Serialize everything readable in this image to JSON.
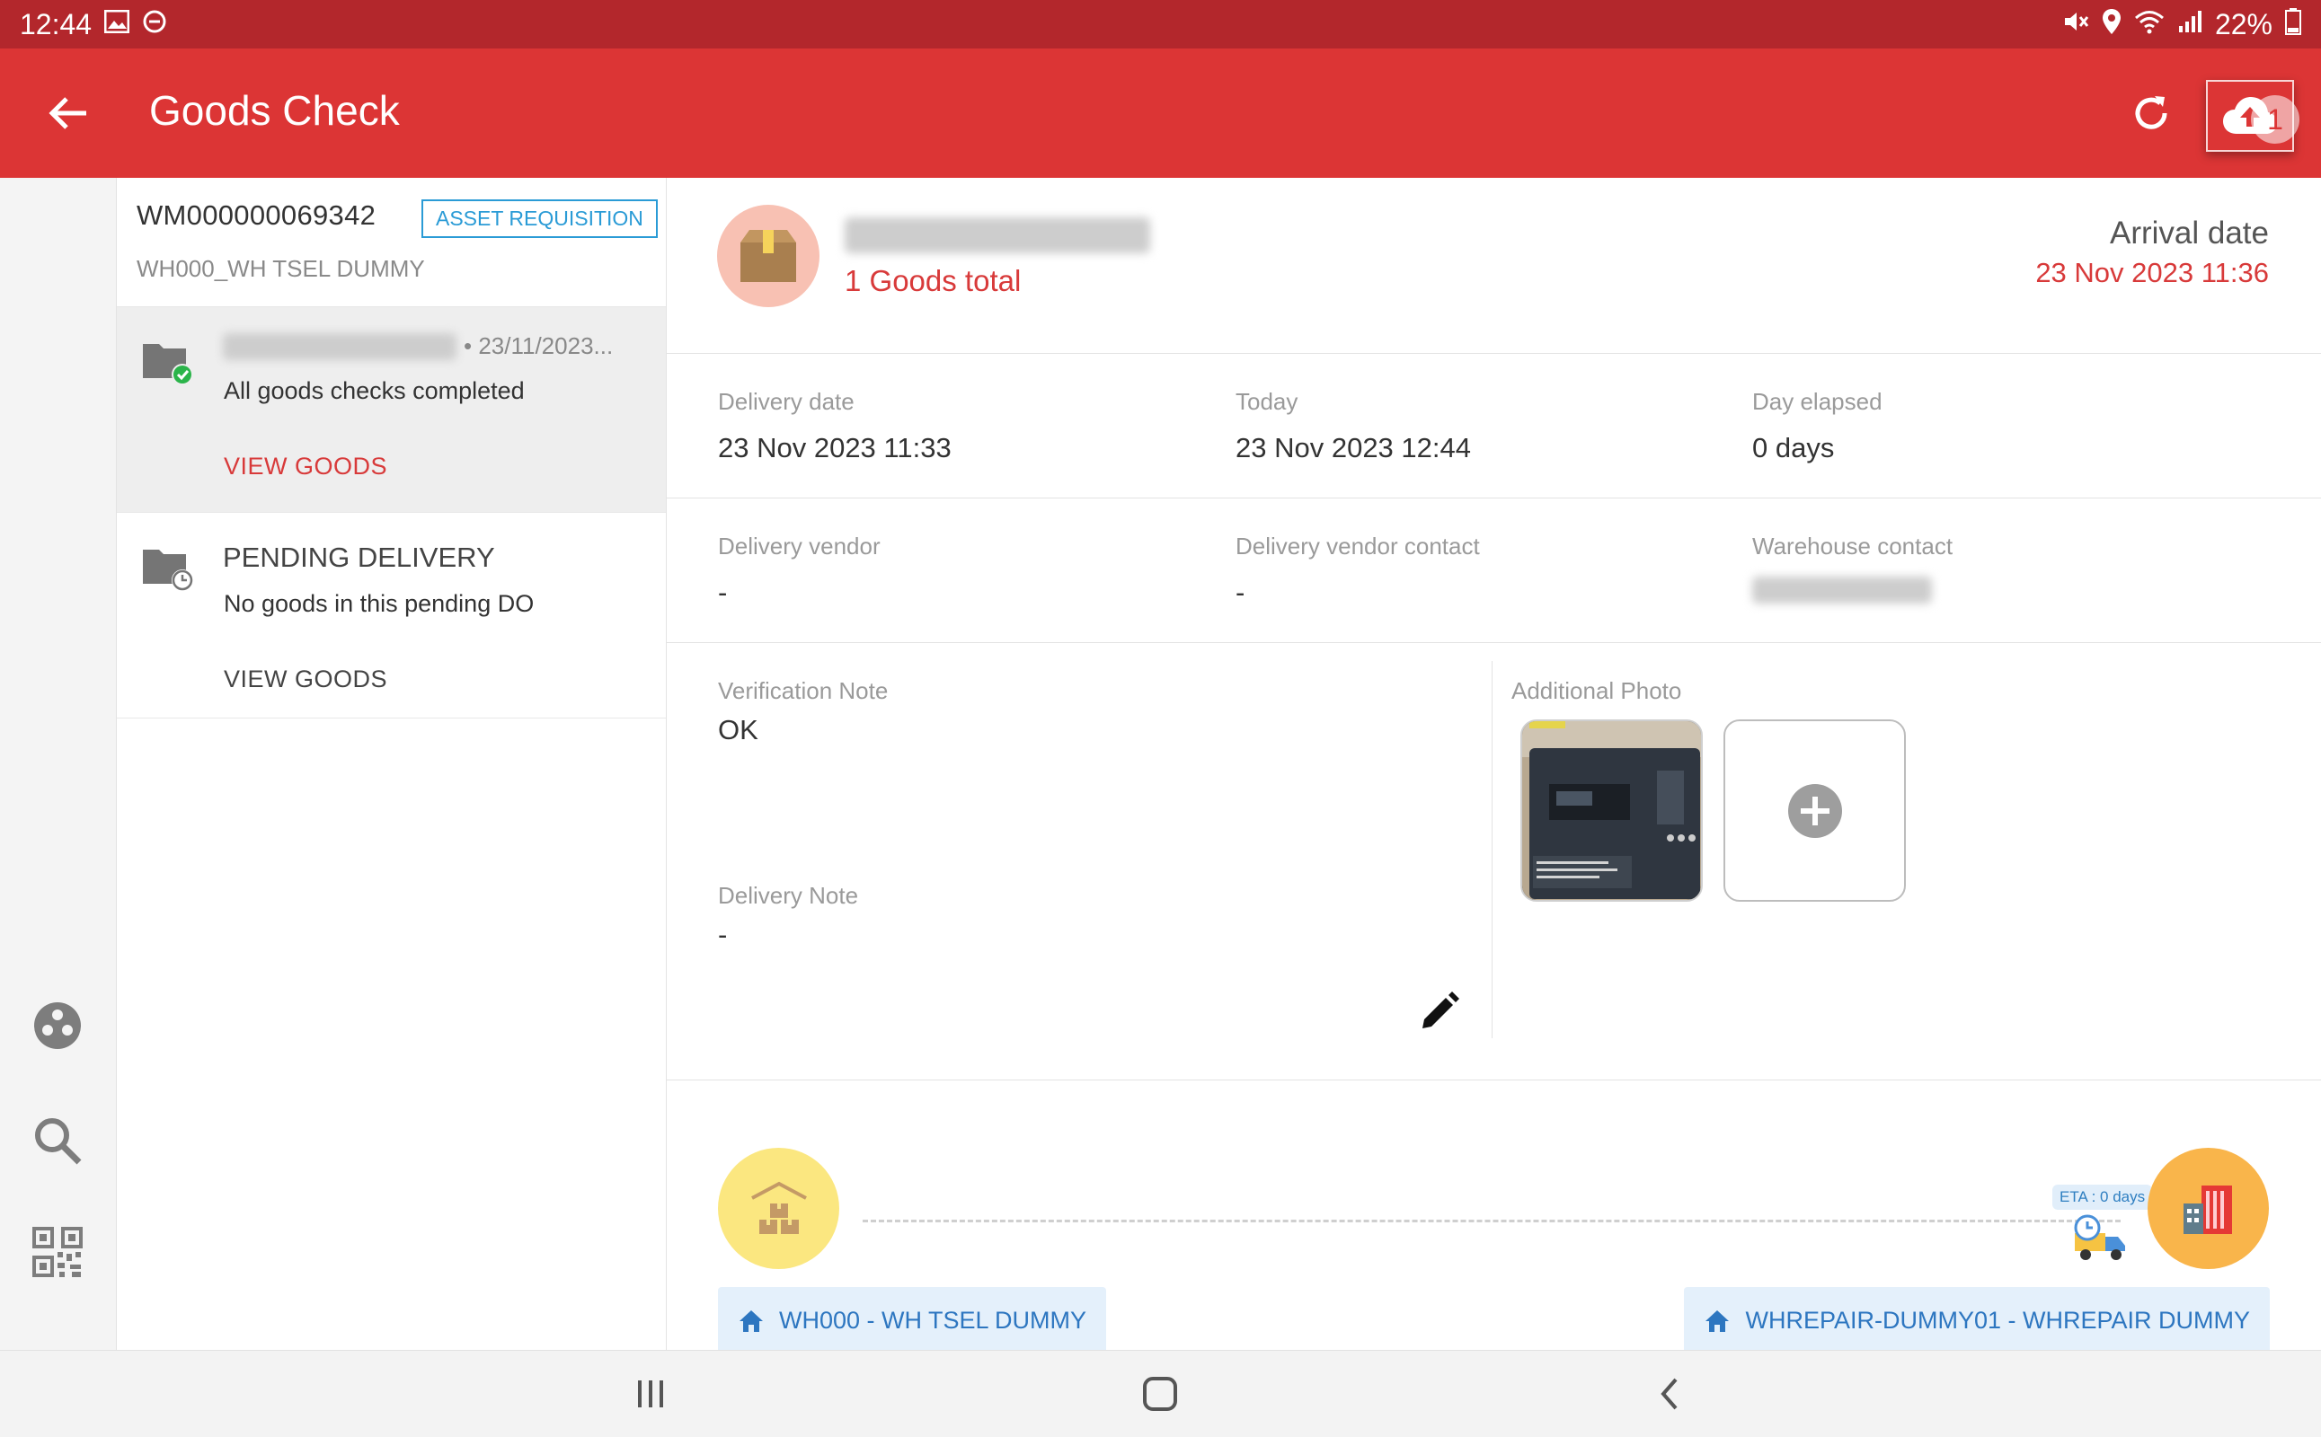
{
  "status_bar": {
    "time": "12:44",
    "battery": "22%",
    "left_icons": [
      "gallery-icon",
      "dnd-icon"
    ],
    "right_icons": [
      "mute-icon",
      "location-icon",
      "wifi-icon",
      "signal-icon",
      "battery-icon"
    ]
  },
  "app_bar": {
    "title": "Goods Check",
    "upload_badge_count": "1",
    "colors": {
      "primary": "#dc3535",
      "status": "#b3272c"
    }
  },
  "left_rail": {
    "icons": [
      "palette-icon",
      "search-icon",
      "qr-code-icon"
    ]
  },
  "list_panel": {
    "wm_number": "WM000000069342",
    "requisition_badge": "ASSET REQUISITION",
    "warehouse": "WH000_WH TSEL DUMMY",
    "items": [
      {
        "do_number_redacted": true,
        "date": "• 23/11/2023...",
        "status": "All goods checks completed",
        "action": "VIEW GOODS"
      },
      {
        "title": "PENDING DELIVERY",
        "status": "No goods in this pending DO",
        "action": "VIEW GOODS"
      }
    ]
  },
  "main": {
    "goods_total": "1 Goods total",
    "arrival_label": "Arrival date",
    "arrival_value": "23 Nov 2023 11:36",
    "row1": {
      "delivery_date_label": "Delivery date",
      "delivery_date_value": "23 Nov 2023 11:33",
      "today_label": "Today",
      "today_value": "23 Nov 2023 12:44",
      "elapsed_label": "Day elapsed",
      "elapsed_value": "0 days"
    },
    "row2": {
      "vendor_label": "Delivery vendor",
      "vendor_value": "-",
      "vendor_contact_label": "Delivery vendor contact",
      "vendor_contact_value": "-",
      "warehouse_contact_label": "Warehouse contact"
    },
    "notes": {
      "verification_label": "Verification Note",
      "verification_value": "OK",
      "delivery_label": "Delivery Note",
      "delivery_value": "-",
      "photo_label": "Additional Photo"
    },
    "route": {
      "eta": "ETA : 0 days",
      "origin": "WH000 - WH TSEL DUMMY",
      "destination": "WHREPAIR-DUMMY01 - WHREPAIR DUMMY"
    }
  }
}
